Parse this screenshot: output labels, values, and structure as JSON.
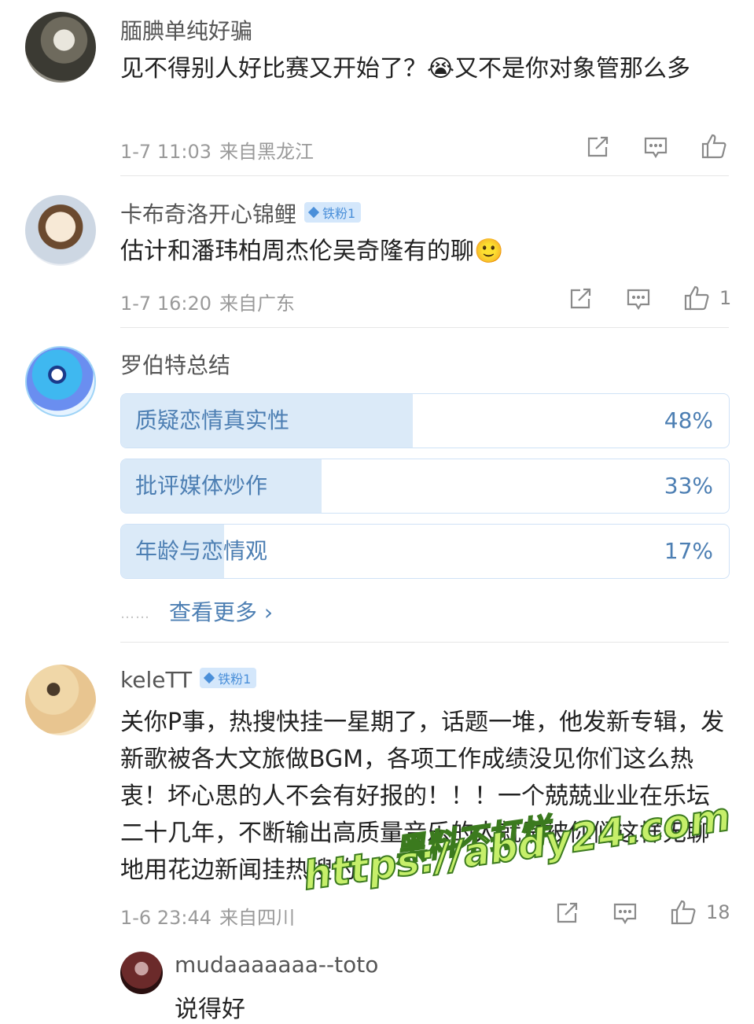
{
  "comments": [
    {
      "username": "腼腆单纯好骗",
      "text_before": "见不得别人好比赛又开始了？",
      "emoji_1": "😭",
      "text_after": "又不是你对象管那么多",
      "time": "1-7 11:03",
      "location": "来自黑龙江",
      "likes": ""
    },
    {
      "username": "卡布奇洛开心锦鲤",
      "badge": "铁粉1",
      "text_before": "估计和潘玮柏周杰伦吴奇隆有的聊",
      "emoji_1": "🙂",
      "time": "1-7 16:20",
      "location": "来自广东",
      "likes": "1"
    },
    {
      "username": "罗伯特总结",
      "poll": [
        {
          "label": "质疑恋情真实性",
          "percent_text": "48%",
          "value": 48
        },
        {
          "label": "批评媒体炒作",
          "percent_text": "33%",
          "value": 33
        },
        {
          "label": "年龄与恋情观",
          "percent_text": "17%",
          "value": 17
        }
      ],
      "more": "查看更多 ›",
      "more_dots": "……"
    },
    {
      "username": "keleTT",
      "badge": "铁粉1",
      "text": "关你P事，热搜快挂一星期了，话题一堆，他发新专辑，发新歌被各大文旅做BGM，各项工作成绩没见你们这么热衷！坏心思的人不会有好报的！！！一个兢兢业业在乐坛二十几年，不断输出高质量音乐的人就是被你们这样无聊地用花边新闻挂热搜的",
      "time": "1-6 23:44",
      "location": "来自四川",
      "likes": "18"
    }
  ],
  "reply": {
    "username": "mudaaaaaaa--toto",
    "text": "说得好"
  },
  "watermark": {
    "line1": "黑料不打烊",
    "line2": "https://abdy24.com"
  },
  "colors": {
    "poll_fill": "#dbeaf8",
    "poll_text": "#4d7fb3",
    "badge_bg": "#d4e7fb",
    "watermark_fill": "#c6ef6a"
  }
}
